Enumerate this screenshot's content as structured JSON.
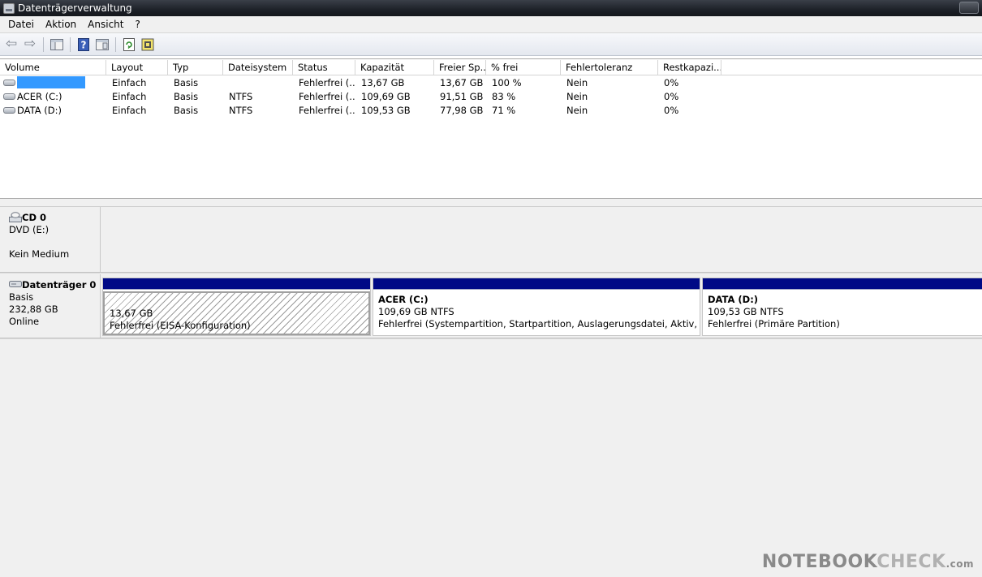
{
  "window": {
    "title": "Datenträgerverwaltung"
  },
  "menu": [
    "Datei",
    "Aktion",
    "Ansicht",
    "?"
  ],
  "toolbar": {
    "buttons": [
      "back-icon",
      "forward-icon",
      "console-tree-icon",
      "help-icon",
      "properties-icon",
      "refresh-icon",
      "disk-check-icon"
    ]
  },
  "columns": [
    "Volume",
    "Layout",
    "Typ",
    "Dateisystem",
    "Status",
    "Kapazität",
    "Freier Sp...",
    "% frei",
    "Fehlertoleranz",
    "Restkapazi..."
  ],
  "rows": [
    {
      "volume": "",
      "layout": "Einfach",
      "typ": "Basis",
      "dateisystem": "",
      "status": "Fehlerfrei (...",
      "kapazitaet": "13,67 GB",
      "frei": "13,67 GB",
      "prozent": "100 %",
      "fehlertoleranz": "Nein",
      "rest": "0%"
    },
    {
      "volume": "ACER (C:)",
      "layout": "Einfach",
      "typ": "Basis",
      "dateisystem": "NTFS",
      "status": "Fehlerfrei (...",
      "kapazitaet": "109,69 GB",
      "frei": "91,51 GB",
      "prozent": "83 %",
      "fehlertoleranz": "Nein",
      "rest": "0%"
    },
    {
      "volume": "DATA (D:)",
      "layout": "Einfach",
      "typ": "Basis",
      "dateisystem": "NTFS",
      "status": "Fehlerfrei (...",
      "kapazitaet": "109,53 GB",
      "frei": "77,98 GB",
      "prozent": "71 %",
      "fehlertoleranz": "Nein",
      "rest": "0%"
    }
  ],
  "cd": {
    "name": "CD 0",
    "drive": "DVD (E:)",
    "media": "Kein Medium"
  },
  "disk": {
    "name": "Datenträger 0",
    "type": "Basis",
    "size": "232,88 GB",
    "state": "Online",
    "partitions": [
      {
        "name": "",
        "size": "13,67 GB",
        "status": "Fehlerfrei (EISA-Konfiguration)"
      },
      {
        "name": "ACER  (C:)",
        "size": "109,69 GB NTFS",
        "status": "Fehlerfrei (Systempartition, Startpartition, Auslagerungsdatei, Aktiv, Absturzabbild, Primäre Partition)"
      },
      {
        "name": "DATA  (D:)",
        "size": "109,53 GB NTFS",
        "status": "Fehlerfrei (Primäre Partition)"
      }
    ]
  },
  "watermark": {
    "main": "NOTEBOOK",
    "second": "CHECK",
    "suffix": ".com"
  },
  "colors": {
    "partition_bar": "#000a86",
    "selection": "#3399ff"
  }
}
